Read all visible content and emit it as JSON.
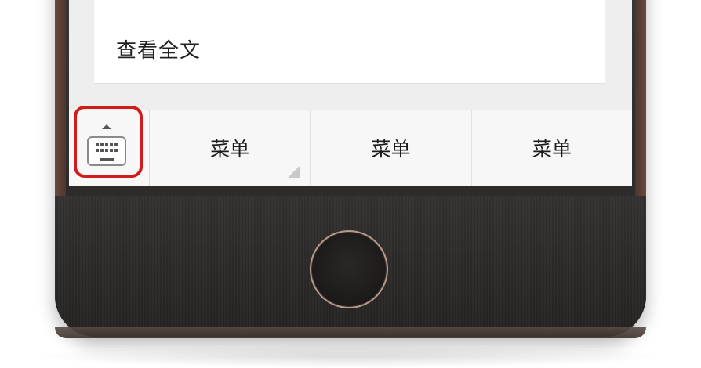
{
  "content": {
    "read_more_label": "查看全文"
  },
  "menu_bar": {
    "keyboard_toggle": {
      "icon": "keyboard-icon",
      "arrow_icon": "arrow-up-icon",
      "highlight_color": "#d11c1c"
    },
    "items": [
      {
        "label": "菜单",
        "has_submenu": true
      },
      {
        "label": "菜单",
        "has_submenu": false
      },
      {
        "label": "菜单",
        "has_submenu": false
      }
    ]
  },
  "device": {
    "home_button_icon": "home-button-icon"
  }
}
